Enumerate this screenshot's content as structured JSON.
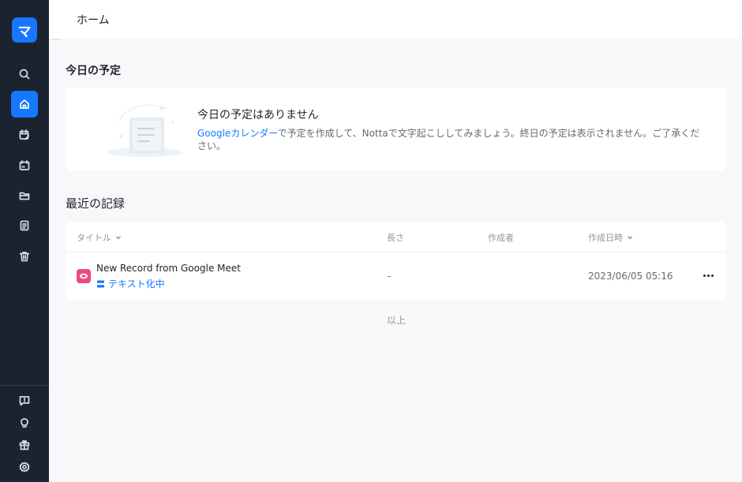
{
  "sidebar": {
    "logo_text": "マ",
    "nav_icons": [
      "search-icon",
      "home-icon",
      "calendar-edit-icon",
      "calendar-icon",
      "folder-icon",
      "document-icon",
      "trash-icon"
    ],
    "bottom_icons": [
      "feedback-icon",
      "lightbulb-icon",
      "gift-icon",
      "settings-icon"
    ],
    "active_item": "home-icon",
    "accent_color": "#1677ff",
    "bg_color": "#1b2230"
  },
  "header": {
    "title": "ホーム"
  },
  "today": {
    "section_title": "今日の予定",
    "empty_title": "今日の予定はありません",
    "desc_link": "Googleカレンダー",
    "desc_text": "で予定を作成して、Nottaで文字起こししてみましょう。終日の予定は表示されません。ご了承ください。"
  },
  "recent": {
    "section_title": "最近の記録",
    "columns": {
      "title": "タイトル",
      "length": "長さ",
      "creator": "作成者",
      "created_at": "作成日時"
    },
    "rows": [
      {
        "name": "New Record from Google Meet",
        "status": "テキスト化中",
        "length": "-",
        "creator": "",
        "created_at": "2023/06/05 05:16",
        "icon": "google-meet-record-icon"
      }
    ],
    "end_text": "以上"
  }
}
